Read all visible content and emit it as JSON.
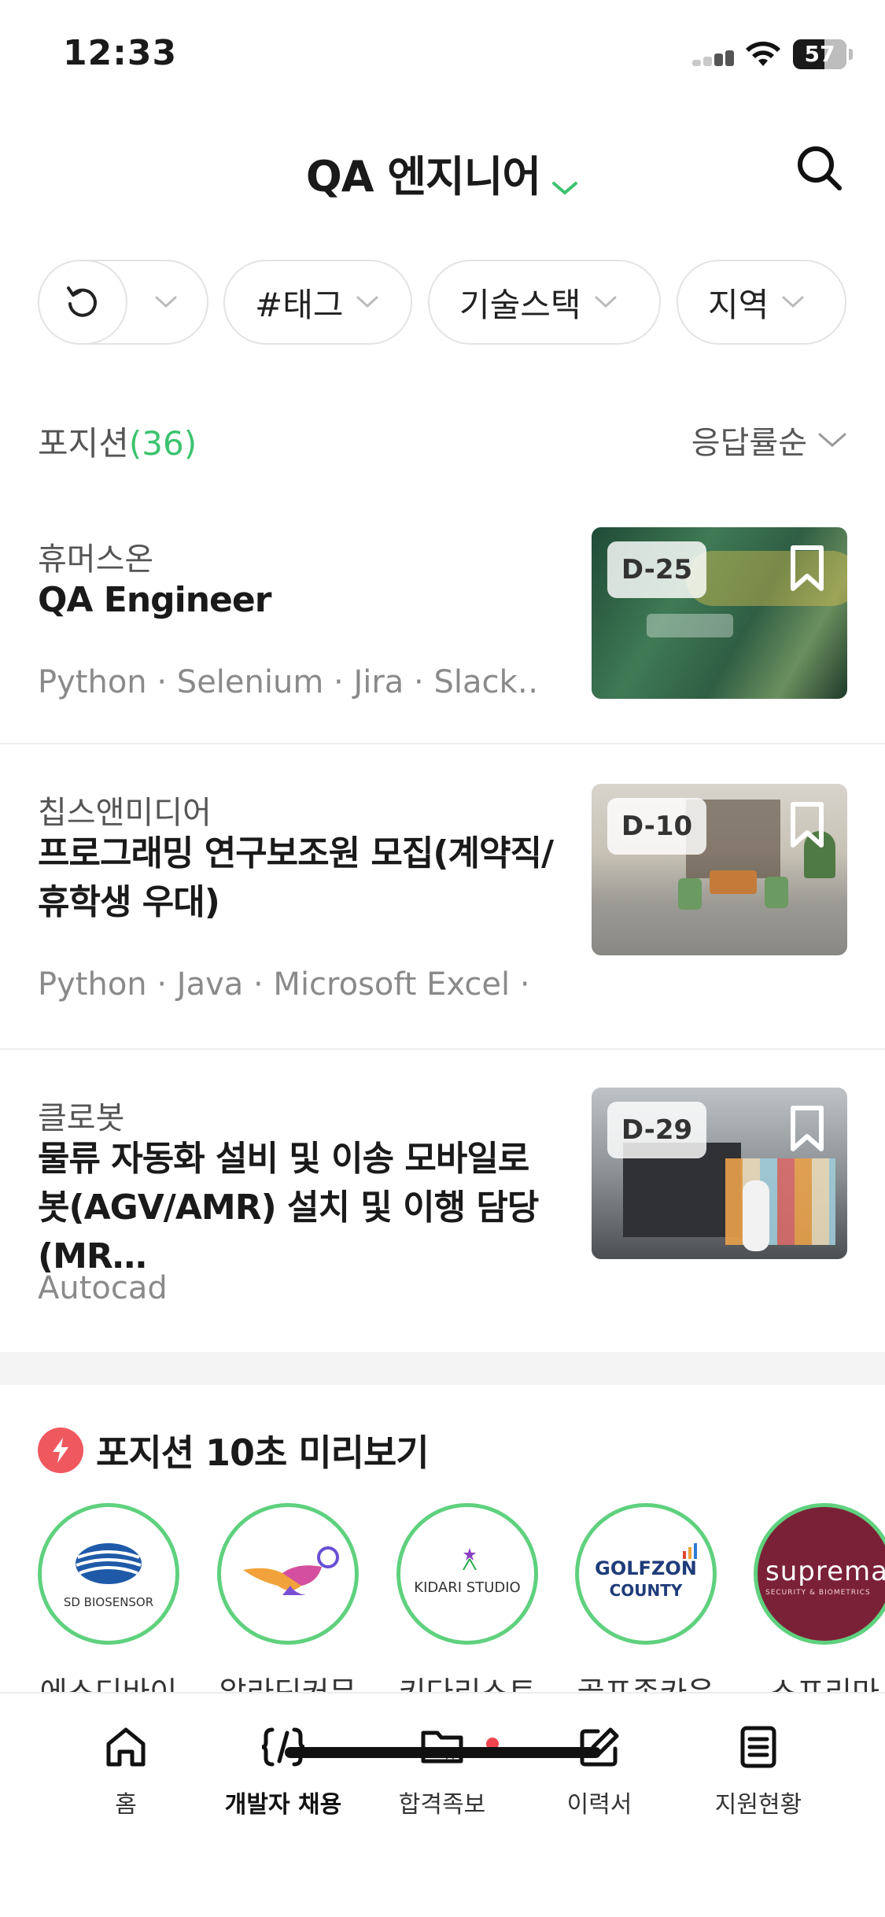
{
  "status": {
    "time": "12:33",
    "battery": "57"
  },
  "header": {
    "title": "QA 엔지니어"
  },
  "filters": {
    "tag": "#태그",
    "stack": "기술스택",
    "region": "지역"
  },
  "list": {
    "title": "포지션",
    "count": "(36)",
    "sort": "응답률순"
  },
  "jobs": [
    {
      "company": "휴머스온",
      "title": "QA Engineer",
      "tags": "Python · Selenium · Jira · Slack…",
      "dday": "D-25",
      "image": "office-glass-sign-photo"
    },
    {
      "company": "칩스앤미디어",
      "title": "프로그래밍 연구보조원 모집(계약직/휴학생 우대)",
      "tags": "Python · Java · Microsoft Excel · …",
      "dday": "D-10",
      "image": "office-lounge-photo"
    },
    {
      "company": "클로봇",
      "title": "물류 자동화 설비 및 이송 모바일로봇(AGV/AMR) 설치 및 이행 담당 (MR…",
      "tags": "Autocad",
      "dday": "D-29",
      "image": "robot-lab-photo"
    }
  ],
  "preview": {
    "title": "포지션 10초 미리보기",
    "companies": [
      {
        "name": "에스디바이",
        "logo": "SD BIOSENSOR"
      },
      {
        "name": "알라딘커뮤",
        "logo": "aladin-lamp"
      },
      {
        "name": "키다리스트",
        "logo": "KIDARI STUDIO"
      },
      {
        "name": "골프존카운",
        "logo_line1": "GOLFZON",
        "logo_line2": "COUNTY"
      },
      {
        "name": "스프리마",
        "logo": "suprema",
        "logo_sub": "SECURITY & BIOMETRICS"
      }
    ]
  },
  "tabs": [
    "홈",
    "개발자 채용",
    "합격족보",
    "이력서",
    "지원현황"
  ],
  "colors": {
    "accent": "#3cc36f",
    "badge": "#f0454f",
    "lightning": "#f0585f"
  }
}
